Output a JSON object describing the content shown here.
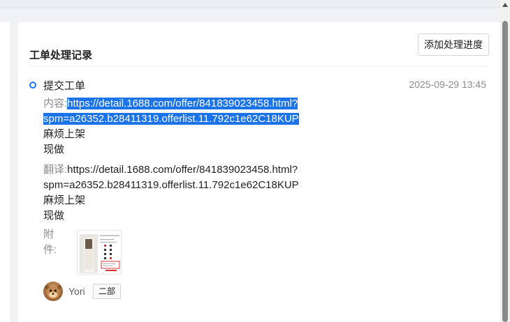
{
  "panel": {
    "title": "工单处理记录",
    "add_button": "添加处理进度"
  },
  "record": {
    "title": "提交工单",
    "time": "2025-09-29 13:45",
    "content_label": "内容:",
    "content_url_line1": "https://detail.1688.com/offer/841839023458.html?",
    "content_url_line2": "spm=a26352.b28411319.offerlist.11.792c1e62C18KUP",
    "content_line3": "麻烦上架",
    "content_line4": "现做",
    "translation_label": "翻译:",
    "translation_url_line1": "https://detail.1688.com/offer/841839023458.html?",
    "translation_url_line2": "spm=a26352.b28411319.offerlist.11.792c1e62C18KUP",
    "translation_line3": "麻烦上架",
    "translation_line4": "现做",
    "attachment_label": "附件:",
    "user_name": "Yori",
    "department": "二部"
  },
  "colors": {
    "accent": "#1677ff",
    "selection": "#1a73e8"
  },
  "icons": {
    "timeline_dot": "timeline-dot-icon",
    "scroll_up": "scroll-up-arrow-icon"
  }
}
